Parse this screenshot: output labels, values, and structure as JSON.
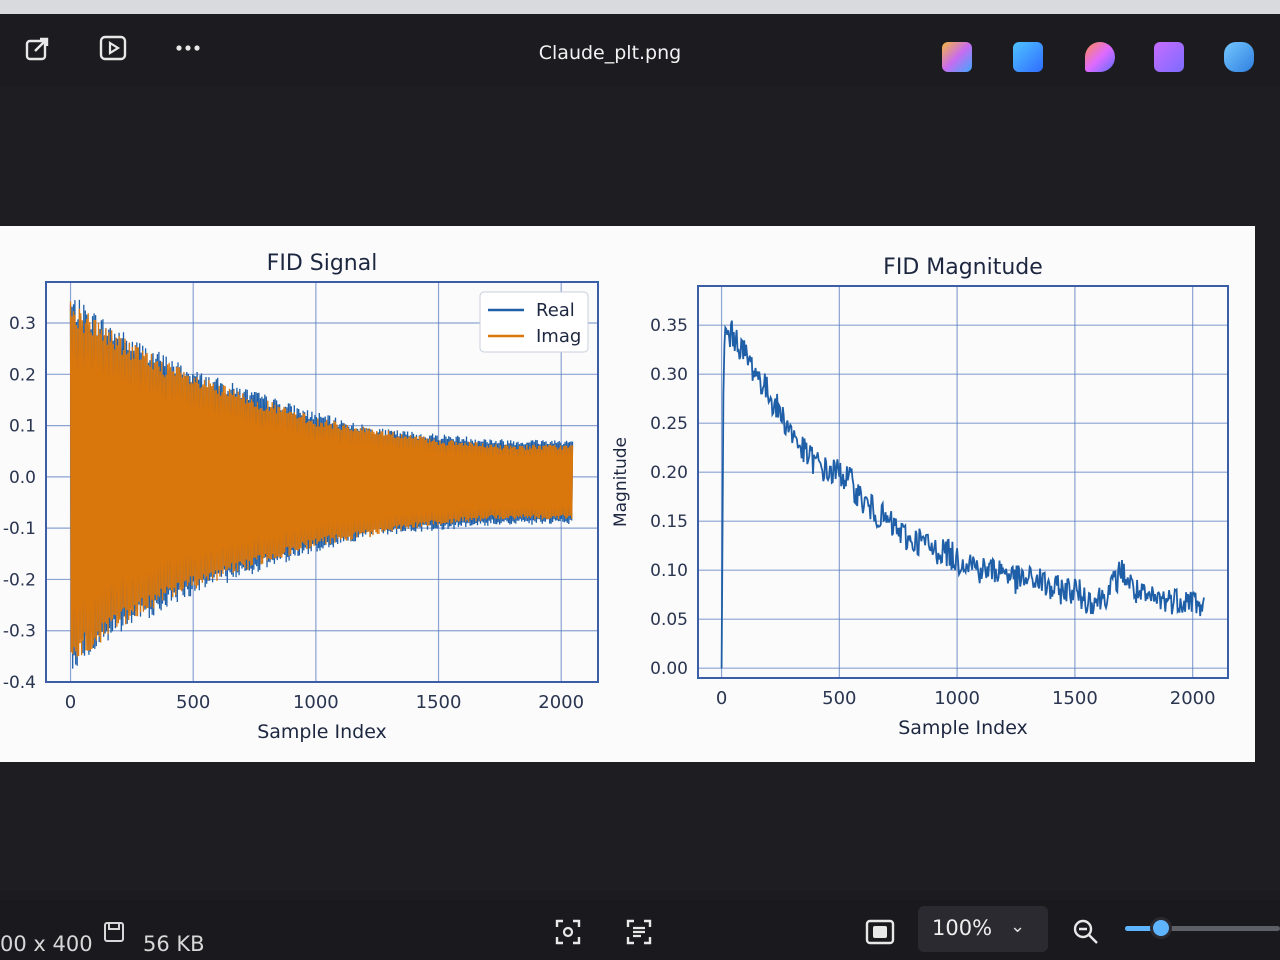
{
  "window": {
    "title": "Claude_plt.png"
  },
  "toolbar": {
    "left_icons": [
      "share-icon",
      "slideshow-icon",
      "more-icon"
    ],
    "right_apps": [
      {
        "name": "copilot-icon",
        "color": "#c86cf0"
      },
      {
        "name": "photos-edit-icon",
        "color": "#2f8cff"
      },
      {
        "name": "clipchamp-icon",
        "color": "#e06aff"
      },
      {
        "name": "film-icon",
        "color": "#9a6cff"
      },
      {
        "name": "onedrive-off-icon",
        "color": "#3d9be9"
      }
    ]
  },
  "status": {
    "dimensions": "00 x 400",
    "file_size": "56 KB",
    "zoom": "100%",
    "zoom_level": 0.1
  },
  "colors": {
    "real": "#1f5fa8",
    "imag": "#d9760c",
    "mag": "#1f5fa8",
    "grid": "#5b7fc0"
  },
  "chart_data": [
    {
      "type": "line",
      "title": "FID Signal",
      "xlabel": "Sample Index",
      "ylabel": "",
      "xlim": [
        -100,
        2150
      ],
      "ylim": [
        -0.4,
        0.38
      ],
      "xticks": [
        "0",
        "500",
        "1000",
        "1500",
        "2000"
      ],
      "xtick_values": [
        0,
        500,
        1000,
        1500,
        2000
      ],
      "yticks": [
        "0.3",
        "0.2",
        "0.1",
        "0.0",
        "-0.1",
        "-0.2",
        "-0.3",
        "-0.4"
      ],
      "ytick_values": [
        0.3,
        0.2,
        0.1,
        0.0,
        -0.1,
        -0.2,
        -0.3,
        -0.4
      ],
      "grid": true,
      "legend": "top-right",
      "series": [
        {
          "name": "Real",
          "envelope_x": [
            0,
            250,
            500,
            750,
            1000,
            1250,
            1500,
            1750,
            2048
          ],
          "envelope_y": [
            0.35,
            0.27,
            0.21,
            0.17,
            0.13,
            0.1,
            0.09,
            0.08,
            0.08
          ]
        },
        {
          "name": "Imag",
          "envelope_x": [
            0,
            250,
            500,
            750,
            1000,
            1250,
            1500,
            1750,
            2048
          ],
          "envelope_y": [
            0.34,
            0.26,
            0.2,
            0.16,
            0.12,
            0.1,
            0.08,
            0.07,
            0.07
          ]
        }
      ]
    },
    {
      "type": "line",
      "title": "FID Magnitude",
      "xlabel": "Sample Index",
      "ylabel": "Magnitude",
      "xlim": [
        -100,
        2150
      ],
      "ylim": [
        -0.01,
        0.39
      ],
      "xticks": [
        "0",
        "500",
        "1000",
        "1500",
        "2000"
      ],
      "xtick_values": [
        0,
        500,
        1000,
        1500,
        2000
      ],
      "yticks": [
        "0.35",
        "0.30",
        "0.25",
        "0.20",
        "0.15",
        "0.10",
        "0.05",
        "0.00"
      ],
      "ytick_values": [
        0.35,
        0.3,
        0.25,
        0.2,
        0.15,
        0.1,
        0.05,
        0.0
      ],
      "grid": true,
      "series": [
        {
          "x": [
            0,
            10,
            50,
            100,
            150,
            200,
            250,
            300,
            350,
            400,
            450,
            500,
            550,
            600,
            650,
            700,
            750,
            800,
            850,
            900,
            950,
            1000,
            1050,
            1100,
            1150,
            1200,
            1250,
            1300,
            1350,
            1400,
            1450,
            1500,
            1550,
            1600,
            1650,
            1700,
            1750,
            1800,
            1850,
            1900,
            1950,
            2000,
            2048
          ],
          "y": [
            0.0,
            0.34,
            0.34,
            0.32,
            0.3,
            0.28,
            0.26,
            0.24,
            0.22,
            0.21,
            0.2,
            0.2,
            0.19,
            0.17,
            0.16,
            0.15,
            0.14,
            0.13,
            0.13,
            0.12,
            0.12,
            0.11,
            0.11,
            0.1,
            0.1,
            0.1,
            0.09,
            0.09,
            0.09,
            0.08,
            0.08,
            0.08,
            0.07,
            0.07,
            0.08,
            0.1,
            0.08,
            0.07,
            0.07,
            0.07,
            0.07,
            0.07,
            0.06
          ]
        }
      ]
    }
  ]
}
